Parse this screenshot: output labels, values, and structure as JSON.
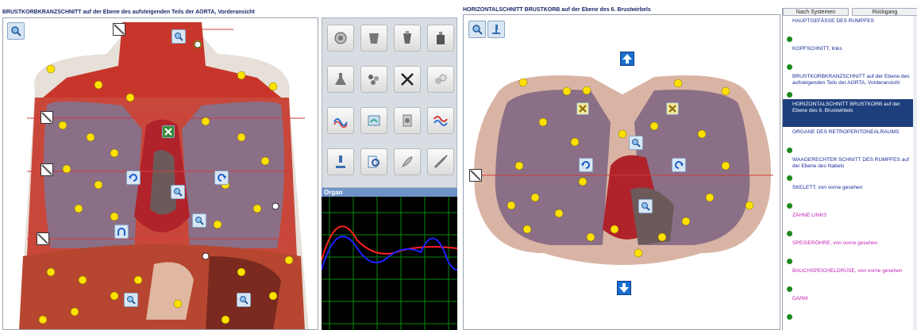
{
  "left": {
    "title": "BRUSTKORBKRANZSCHNITT auf der Ebene des aufsteigenden Teils der AORTA, Vorderansicht",
    "organ_label": "Organ",
    "toolbar": [
      {
        "name": "target-icon"
      },
      {
        "name": "cup-icon"
      },
      {
        "name": "vessel-icon"
      },
      {
        "name": "bottle-icon"
      },
      {
        "name": "flask-icon"
      },
      {
        "name": "dots-icon"
      },
      {
        "name": "close-x-icon"
      },
      {
        "name": "cells-icon"
      },
      {
        "name": "wave-pen-icon"
      },
      {
        "name": "body-scan-icon"
      },
      {
        "name": "organ-tool-icon"
      },
      {
        "name": "spectrum-icon"
      },
      {
        "name": "microscope-icon"
      },
      {
        "name": "zoom-tool-icon"
      },
      {
        "name": "feather-icon"
      },
      {
        "name": "syringe-icon"
      }
    ],
    "graph_colors": {
      "red": "#ff2020",
      "blue": "#2020ff",
      "grid": "#0a8a0a"
    }
  },
  "right": {
    "title": "HORIZONTALSCHNITT BRUSTKORB auf der Ebene des 6. Brustwirbels",
    "top_buttons": [
      "Nach Systemen",
      "Rückgang"
    ],
    "items": [
      {
        "label": "HAUPTGEFÄSSE DES RUMPFES",
        "style": "normal"
      },
      {
        "label": "KOPFSCHNITT, links",
        "style": "normal"
      },
      {
        "label": "BRUSTKORBKRANZSCHNITT auf der Ebene des aufsteigenden Teils der AORTA, Vorderansicht",
        "style": "normal"
      },
      {
        "label": "HORIZONTALSCHNITT BRUSTKORB auf der Ebene des 6. Brustwirbels",
        "style": "selected"
      },
      {
        "label": "ORGANE DES RETROPERITONEALRAUMS",
        "style": "normal"
      },
      {
        "label": "WAAGERECHTER SCHNITT DES RUMPFES auf der Ebene des Nabels",
        "style": "normal"
      },
      {
        "label": "SKELETT;  von vorne gesehen",
        "style": "normal"
      },
      {
        "label": "ZÄHNE LINKS",
        "style": "pink"
      },
      {
        "label": "SPEISERÖHRE;  von vorne gesehen",
        "style": "pink"
      },
      {
        "label": "BAUCHSPEICHELDRÜSE, von vorne gesehen",
        "style": "pink"
      },
      {
        "label": "DARM",
        "style": "pink"
      }
    ]
  }
}
